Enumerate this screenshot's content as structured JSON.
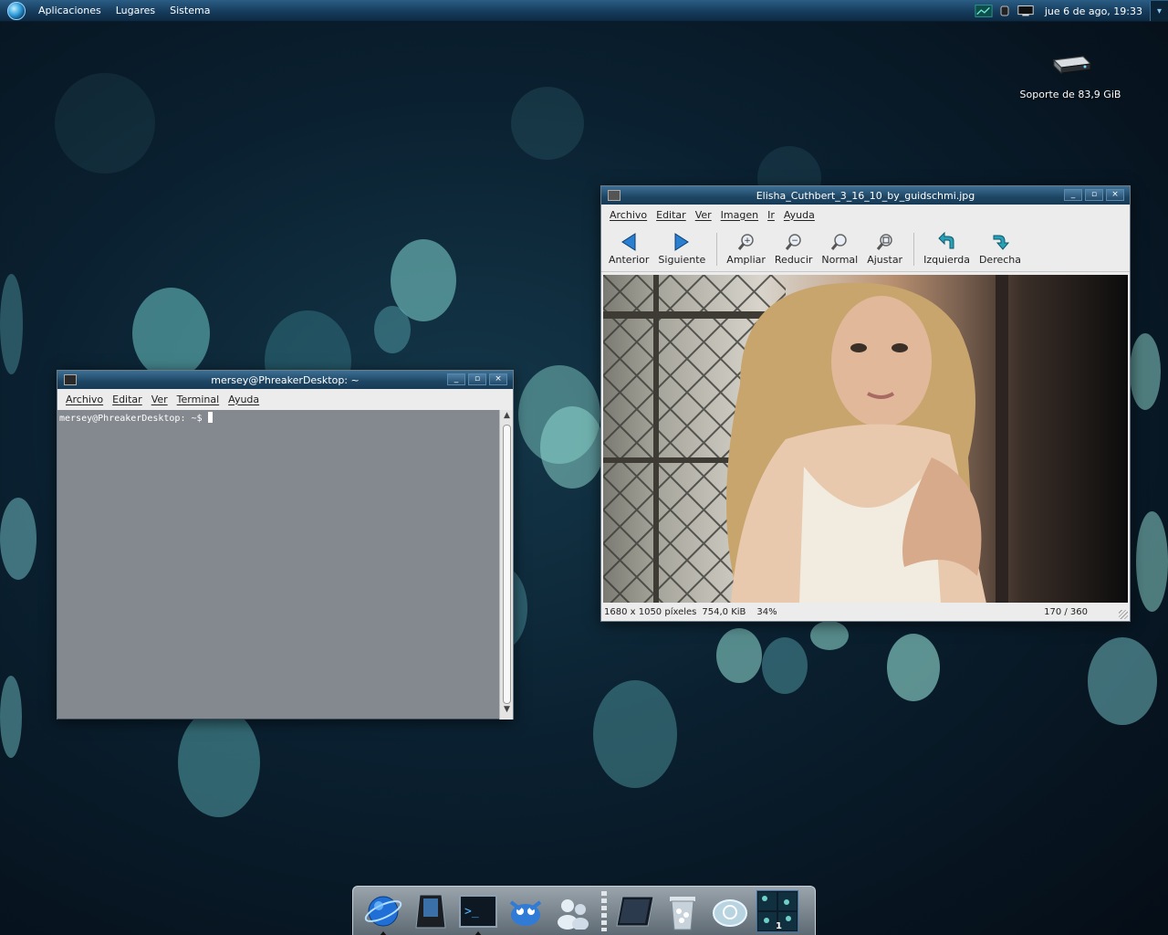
{
  "top_panel": {
    "menus": [
      "Aplicaciones",
      "Lugares",
      "Sistema"
    ],
    "clock": "jue  6 de ago, 19:33"
  },
  "desktop": {
    "icons": [
      {
        "label": "Soporte de 83,9 GiB",
        "icon": "drive-icon"
      }
    ]
  },
  "terminal": {
    "title": "mersey@PhreakerDesktop: ~",
    "menus": [
      "Archivo",
      "Editar",
      "Ver",
      "Terminal",
      "Ayuda"
    ],
    "prompt": "mersey@PhreakerDesktop: ~$"
  },
  "viewer": {
    "title": "Elisha_Cuthbert_3_16_10_by_guidschmi.jpg",
    "menus": [
      "Archivo",
      "Editar",
      "Ver",
      "Imagen",
      "Ir",
      "Ayuda"
    ],
    "toolbar": {
      "previous": "Anterior",
      "next": "Siguiente",
      "zoom_in": "Ampliar",
      "zoom_out": "Reducir",
      "normal": "Normal",
      "fit": "Ajustar",
      "rotate_left": "Izquierda",
      "rotate_right": "Derecha"
    },
    "status": {
      "dimensions": "1680 x 1050 píxeles",
      "size": "754,0 KiB",
      "zoom": "34%",
      "counter": "170 / 360"
    }
  },
  "dock": {
    "items": [
      "browser-icon",
      "system-icon",
      "terminal-icon",
      "gimp-icon",
      "chat-icon",
      "tablet-icon",
      "trash-icon",
      "power-icon",
      "workspace-switcher"
    ],
    "workspace_number": "1"
  },
  "colors": {
    "panel": "#163c5c",
    "titlebar": "#1d4563",
    "bokeh": "#7fd6d0",
    "desktop": "#0a2030"
  }
}
